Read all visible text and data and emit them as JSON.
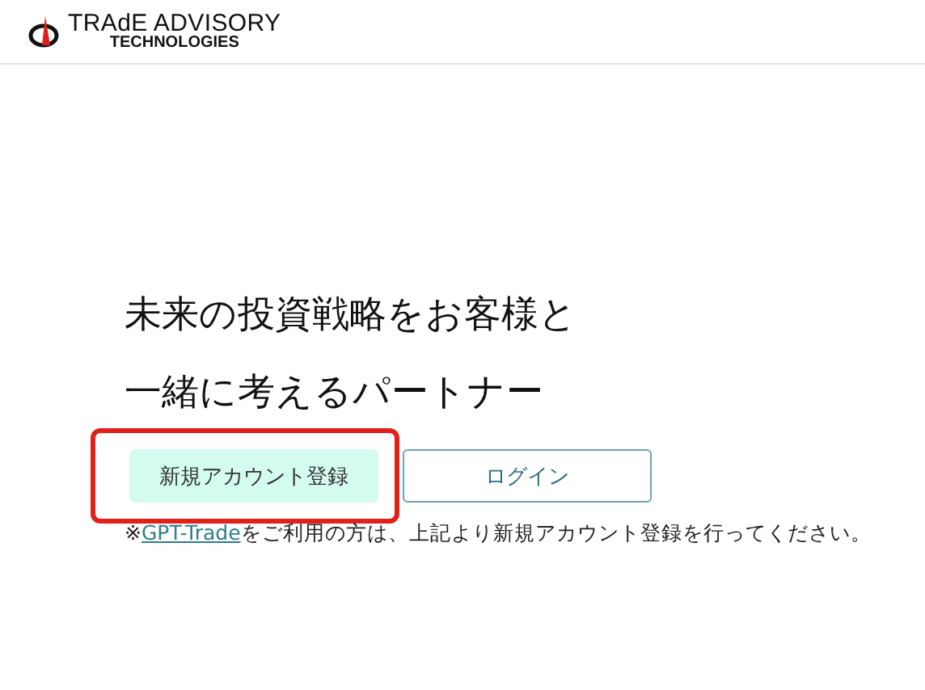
{
  "header": {
    "logo": {
      "line_1": "TRAdE ADVISORY",
      "line_2": "TECHNOLOGIES"
    }
  },
  "headline": [
    "未来の投資戦略をお客様と",
    "一緒に考えるパートナー"
  ],
  "buttons": [
    {
      "kind": "primary",
      "label": "新規アカウント登録",
      "highlighted": true
    },
    {
      "kind": "outline",
      "label": "ログイン",
      "highlighted": false
    }
  ],
  "note": {
    "prefix": "※",
    "link": "GPT-Trade",
    "suffix": "をご利用の方は、上記より新規アカウント登録を行ってください。"
  }
}
